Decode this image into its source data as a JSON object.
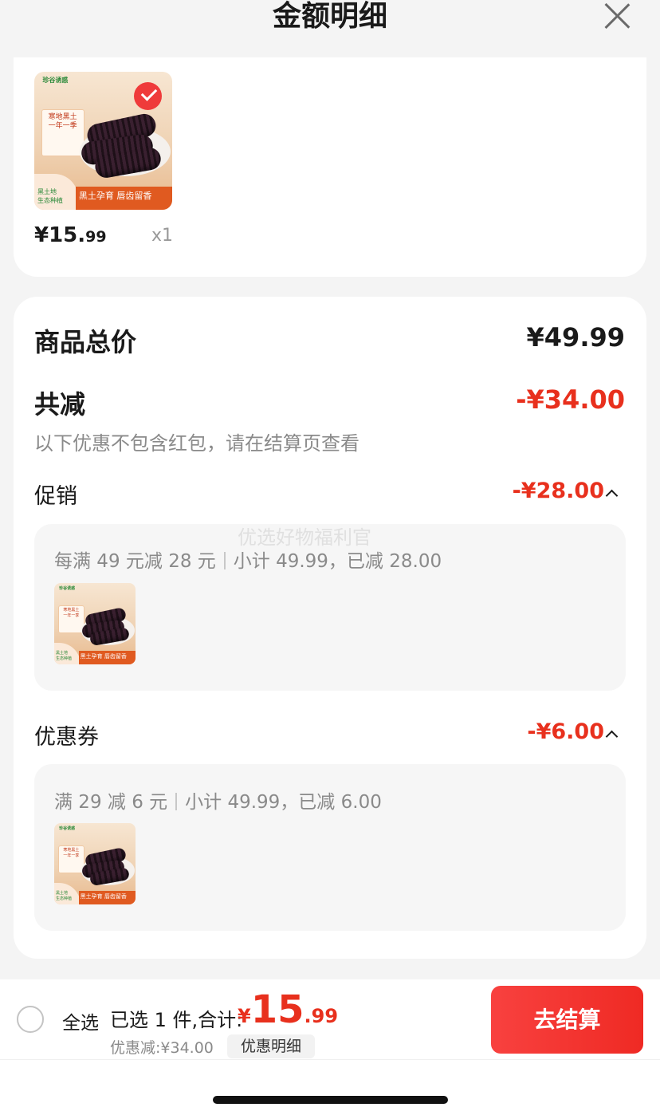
{
  "header": {
    "title": "金额明细"
  },
  "product": {
    "image_texts": {
      "brand": "珍谷诱惑",
      "tag": "寒地黑土\n一年一季",
      "green": "黑土地\n生态种植",
      "banner": "黑土孕育 唇齿留香"
    },
    "price_main": "¥15.",
    "price_decimal": "99",
    "quantity": "x1"
  },
  "summary_card": {
    "total_label": "商品总价",
    "total_value": "¥49.99",
    "reduced_label": "共减",
    "reduced_value": "-¥34.00",
    "note": "以下优惠不包含红包，请在结算页查看",
    "promotion": {
      "label": "促销",
      "value": "-¥28.00",
      "rule": "每满 49 元减 28 元",
      "subtotal": "小计 49.99，已减 28.00"
    },
    "coupon": {
      "label": "优惠券",
      "value": "-¥6.00",
      "rule": "满 29 减 6 元",
      "subtotal": "小计 49.99，已减 6.00"
    },
    "watermark": "优选好物福利官"
  },
  "bottom": {
    "select_all": "全选",
    "selected_text": "已选 1 件,合计:",
    "total_currency": "¥",
    "total_int": "15",
    "total_decimal": ".99",
    "discount": "优惠减:¥34.00",
    "detail_button": "优惠明细",
    "checkout_button": "去结算"
  },
  "colors": {
    "accent": "#e8301d",
    "checkout": "#f33b36"
  }
}
